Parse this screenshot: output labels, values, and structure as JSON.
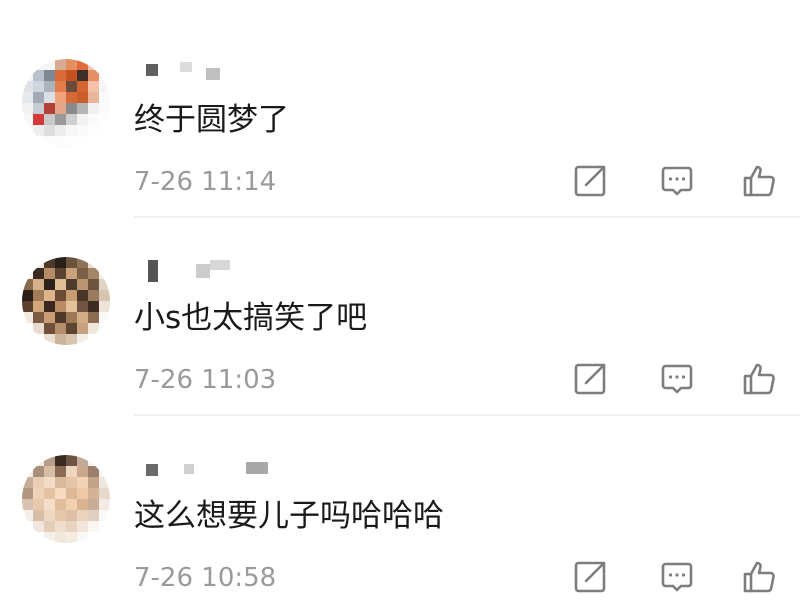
{
  "comments": [
    {
      "text": "终于圆梦了",
      "time": "7-26 11:14",
      "icons": {
        "forward": "share-edit-icon",
        "reply": "comment-bubble-icon",
        "like": "thumbs-up-icon"
      }
    },
    {
      "text": "小s也太搞笑了吧",
      "time": "7-26 11:03",
      "icons": {
        "forward": "share-edit-icon",
        "reply": "comment-bubble-icon",
        "like": "thumbs-up-icon"
      }
    },
    {
      "text": "这么想要儿子吗哈哈哈",
      "time": "7-26 10:58",
      "icons": {
        "forward": "share-edit-icon",
        "reply": "comment-bubble-icon",
        "like": "thumbs-up-icon"
      }
    }
  ],
  "colors": {
    "text": "#1a1a1a",
    "meta": "#9a9a9a",
    "icon": "#7d7d7d",
    "divider": "#f1f1f1"
  }
}
